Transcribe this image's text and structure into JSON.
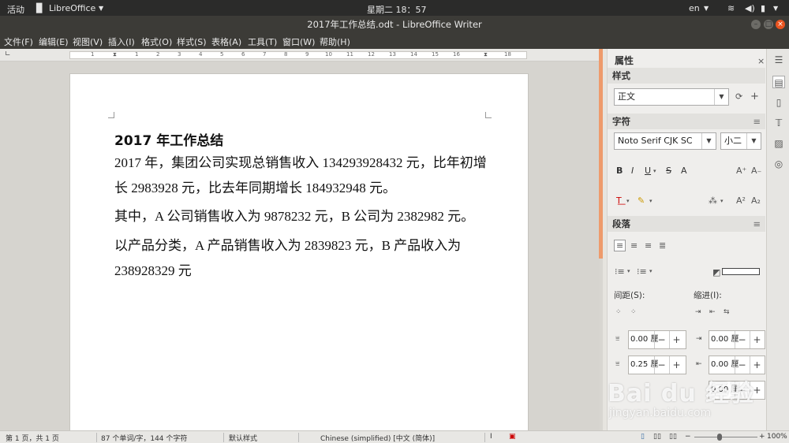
{
  "topbar": {
    "activities": "活动",
    "app_name": "LibreOffice",
    "clock": "星期二 18：57",
    "lang": "en"
  },
  "window": {
    "title": "2017年工作总结.odt - LibreOffice Writer"
  },
  "menu": [
    "文件(F)",
    "编辑(E)",
    "视图(V)",
    "插入(I)",
    "格式(O)",
    "样式(S)",
    "表格(A)",
    "工具(T)",
    "窗口(W)",
    "帮助(H)"
  ],
  "ruler": {
    "numbers": [
      "1",
      "1",
      "2",
      "3",
      "4",
      "5",
      "6",
      "7",
      "8",
      "9",
      "10",
      "11",
      "12",
      "13",
      "14",
      "15",
      "16",
      "17",
      "18"
    ]
  },
  "document": {
    "heading": "2017 年工作总结",
    "paragraphs": [
      "2017 年，集团公司实现总销售收入 134293928432 元，比年初增长 2983928 元，比去年同期增长 184932948 元。",
      "其中，A 公司销售收入为 9878232 元，B 公司为 2382982 元。",
      "以产品分类，A 产品销售收入为 2839823 元，B 产品收入为 238928329 元"
    ]
  },
  "sidebar": {
    "title": "属性",
    "close": "×",
    "styles": {
      "header": "样式",
      "value": "正文"
    },
    "character": {
      "header": "字符",
      "font": "Noto Serif CJK SC",
      "size": "小二",
      "bold": "B",
      "italic": "I",
      "underline": "U",
      "strike": "S",
      "shadow": "A",
      "grow": "A⁺",
      "shrink": "A₋",
      "super": "A²",
      "sub": "A₂"
    },
    "paragraph": {
      "header": "段落",
      "spacing_label": "间距(S):",
      "indent_label": "缩进(I):",
      "spacing_above": "0.00 厘",
      "spacing_below": "0.25 厘",
      "indent_before": "0.00 厘",
      "indent_after": "0.00 厘",
      "third_value": "0.00 厘"
    }
  },
  "status": {
    "page": "第 1 页，共 1 页",
    "words": "87 个单词/字，144 个字符",
    "style": "默认样式",
    "language": "Chinese (simplified) [中文 (简体)]",
    "zoom": "100%"
  },
  "watermark": {
    "brand": "Bai du 经验",
    "url": "jingyan.baidu.com"
  }
}
